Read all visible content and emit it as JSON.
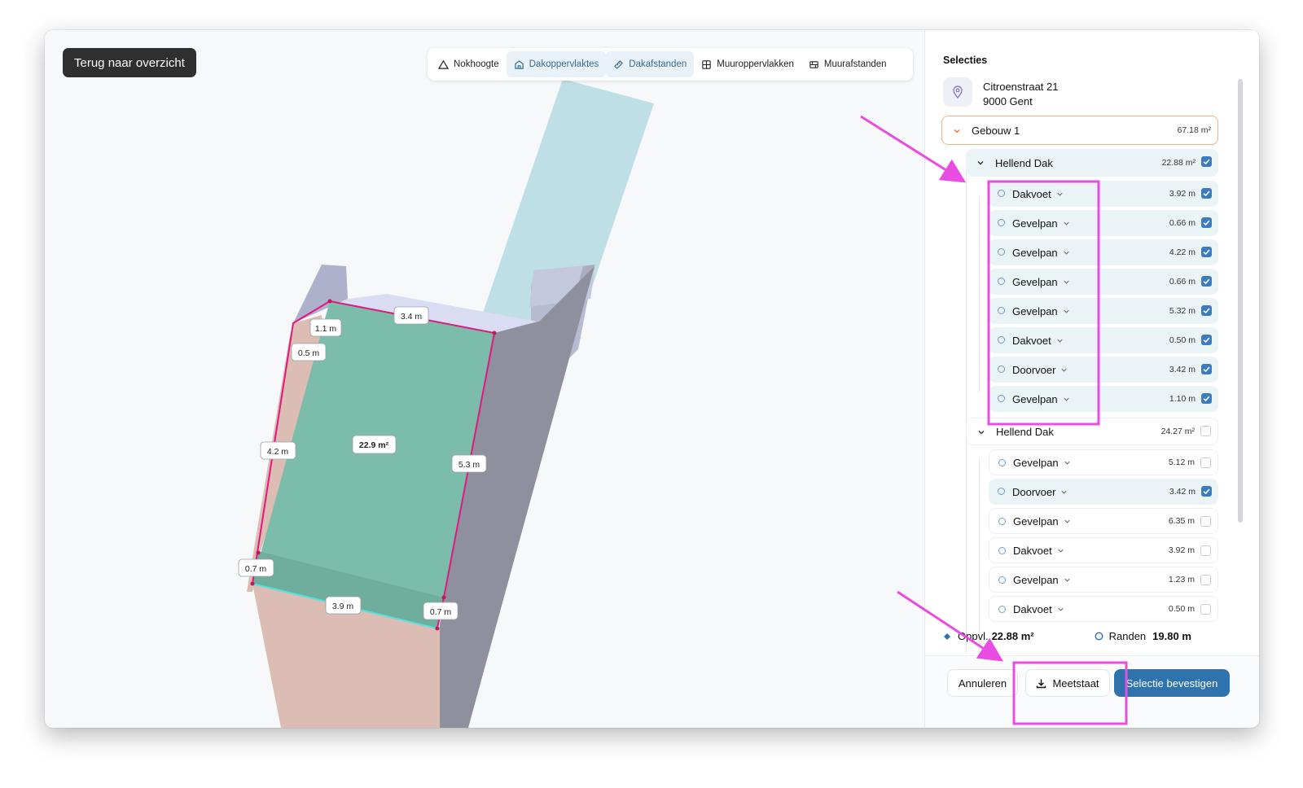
{
  "back_button": {
    "label": "Terug naar overzicht"
  },
  "toolbar": {
    "items": [
      {
        "label": "Nokhoogte",
        "icon": "triangle-icon",
        "active": false
      },
      {
        "label": "Dakoppervlaktes",
        "icon": "house-icon",
        "active": true
      },
      {
        "label": "Dakafstanden",
        "icon": "ruler-icon",
        "active": true
      },
      {
        "label": "Muuroppervlakken",
        "icon": "wall-grid-icon",
        "active": false
      },
      {
        "label": "Muurafstanden",
        "icon": "wall-distance-icon",
        "active": false
      }
    ]
  },
  "measurements": {
    "area": "22.9 m²",
    "edges": [
      "3.4 m",
      "1.1 m",
      "0.5 m",
      "4.2 m",
      "5.3 m",
      "0.7 m",
      "3.9 m",
      "0.7 m"
    ]
  },
  "panel": {
    "title": "Selecties",
    "address_line1": "Citroenstraat 21",
    "address_line2": "9000 Gent",
    "building": {
      "label": "Gebouw 1",
      "value": "67.18 m²"
    },
    "groups": [
      {
        "label": "Hellend Dak",
        "value": "22.88 m²",
        "checked": true,
        "items": [
          {
            "label": "Dakvoet",
            "value": "3.92 m",
            "checked": true
          },
          {
            "label": "Gevelpan",
            "value": "0.66 m",
            "checked": true
          },
          {
            "label": "Gevelpan",
            "value": "4.22 m",
            "checked": true
          },
          {
            "label": "Gevelpan",
            "value": "0.66 m",
            "checked": true
          },
          {
            "label": "Gevelpan",
            "value": "5.32 m",
            "checked": true
          },
          {
            "label": "Dakvoet",
            "value": "0.50 m",
            "checked": true
          },
          {
            "label": "Doorvoer",
            "value": "3.42 m",
            "checked": true
          },
          {
            "label": "Gevelpan",
            "value": "1.10 m",
            "checked": true
          }
        ]
      },
      {
        "label": "Hellend Dak",
        "value": "24.27 m²",
        "checked": false,
        "items": [
          {
            "label": "Gevelpan",
            "value": "5.12 m",
            "checked": false
          },
          {
            "label": "Doorvoer",
            "value": "3.42 m",
            "checked": true
          },
          {
            "label": "Gevelpan",
            "value": "6.35 m",
            "checked": false
          },
          {
            "label": "Dakvoet",
            "value": "3.92 m",
            "checked": false
          },
          {
            "label": "Gevelpan",
            "value": "1.23 m",
            "checked": false
          },
          {
            "label": "Dakvoet",
            "value": "0.50 m",
            "checked": false
          }
        ]
      }
    ],
    "summary": {
      "area_label": "Oppvl.",
      "area_value": "22.88 m²",
      "edges_label": "Randen",
      "edges_value": "19.80 m"
    },
    "buttons": {
      "cancel": "Annuleren",
      "export": "Meetstaat",
      "confirm": "Selectie bevestigen"
    }
  },
  "colors": {
    "accent": "#2f73ad",
    "selected_row": "#eaf4f7",
    "roof_face": "#7bbcaa",
    "edge_highlight": "#e0187f",
    "annotation": "#e94ce0"
  }
}
